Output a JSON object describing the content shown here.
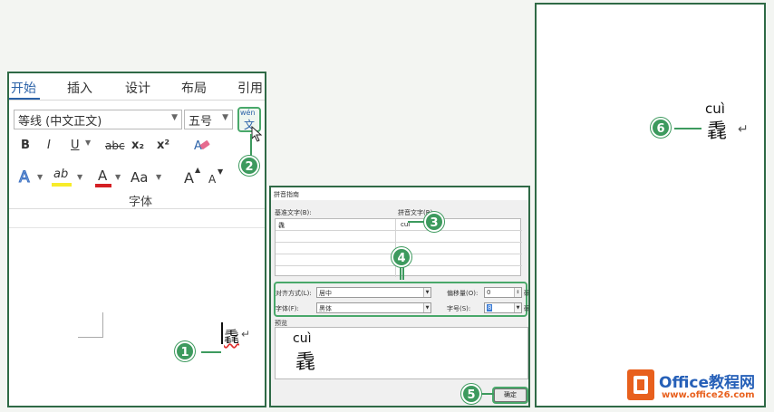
{
  "ribbon": {
    "tabs": [
      {
        "label": "开始",
        "active": true
      },
      {
        "label": "插入",
        "active": false
      },
      {
        "label": "设计",
        "active": false
      },
      {
        "label": "布局",
        "active": false
      },
      {
        "label": "引用",
        "active": false
      }
    ],
    "font_name": "等线 (中文正文)",
    "font_size": "五号",
    "phonetic_guide_top": "wén",
    "phonetic_guide_char": "文",
    "bold": "B",
    "italic": "I",
    "underline": "U",
    "strike": "abc",
    "subscript": "x₂",
    "superscript": "x²",
    "text_effects": "A",
    "highlight": "ab",
    "font_color": "A",
    "change_case": "Aa",
    "grow_font": "A",
    "shrink_font": "A",
    "group_label": "字体"
  },
  "document": {
    "char": "毳",
    "return_mark": "↵"
  },
  "dialog": {
    "title": "拼音指南",
    "base_label": "基准文字(B):",
    "ruby_label": "拼音文字(R):",
    "base_value": "毳",
    "ruby_value": "cui",
    "align_label": "对齐方式(L):",
    "align_value": "居中",
    "offset_label": "偏移量(O):",
    "offset_value": "0",
    "offset_unit": "磅",
    "font_label": "字体(F):",
    "font_value": "黑体",
    "size_label": "字号(S):",
    "size_value": "8",
    "size_unit": "磅",
    "preview_label": "预览",
    "preview_ruby": "cuì",
    "preview_char": "毳",
    "ok_label": "确定"
  },
  "result": {
    "ruby": "cuì",
    "char": "毳",
    "return_mark": "↵"
  },
  "steps": [
    "1",
    "2",
    "3",
    "4",
    "5",
    "6"
  ],
  "watermark": {
    "brand": "Office教程网",
    "url": "www.office26.com"
  },
  "colors": {
    "accent_green": "#3d9a5e",
    "frame_green": "#2f6a46",
    "logo_orange": "#e8601d",
    "tab_blue": "#2b62a8"
  }
}
